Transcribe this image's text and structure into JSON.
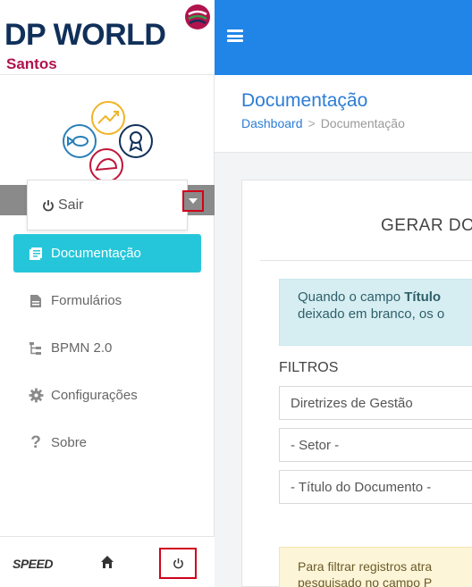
{
  "logo": {
    "main": "DP WORLD",
    "sub": "Santos"
  },
  "user": {
    "logout_label": "Sair"
  },
  "nav": {
    "items": [
      {
        "label": "Documentação",
        "icon": "document-list-icon",
        "active": true
      },
      {
        "label": "Formulários",
        "icon": "file-icon",
        "active": false
      },
      {
        "label": "BPMN 2.0",
        "icon": "sitemap-icon",
        "active": false
      },
      {
        "label": "Configurações",
        "icon": "gear-icon",
        "active": false
      },
      {
        "label": "Sobre",
        "icon": "question-icon",
        "active": false
      }
    ]
  },
  "footer": {
    "brand": "SPEED"
  },
  "page": {
    "title": "Documentação",
    "breadcrumb": [
      "Dashboard",
      "Documentação"
    ]
  },
  "card": {
    "title": "GERAR DOC",
    "info_line1_prefix": "Quando o campo ",
    "info_line1_bold": "Título",
    "info_line2": "deixado em branco, os o",
    "filters_label": "FILTROS",
    "fields": [
      {
        "value": "Diretrizes de Gestão"
      },
      {
        "value": "- Setor -"
      },
      {
        "value": "- Título do Documento -"
      }
    ],
    "warn_line1": "Para filtrar registros atra",
    "warn_line2": "pesquisado no campo P"
  },
  "colors": {
    "topbar": "#2185e8",
    "active_nav": "#26c6da",
    "highlight": "#d0021b",
    "title_blue": "#2c7dd5"
  }
}
